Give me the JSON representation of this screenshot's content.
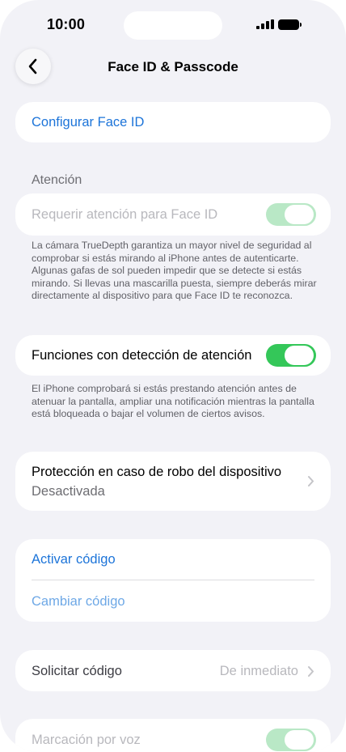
{
  "status_bar": {
    "time": "10:00"
  },
  "nav": {
    "title": "Face ID & Passcode"
  },
  "face_id": {
    "setup_label": "Configurar Face ID"
  },
  "attention": {
    "header": "Atención",
    "require_label": "Requerir atención para Face ID",
    "require_enabled": true,
    "require_disabled_state": true,
    "require_footnote": "La cámara TrueDepth garantiza un mayor nivel de seguridad al comprobar si estás mirando al iPhone antes de autenticarte. Algunas gafas de sol pueden impedir que se detecte si estás mirando. Si llevas una mascarilla puesta, siempre deberás mirar directamente al dispositivo para que Face ID te reconozca.",
    "aware_label": "Funciones con detección de atención",
    "aware_enabled": true,
    "aware_footnote": "El iPhone comprobará si estás prestando atención antes de atenuar la pantalla, ampliar una notificación mientras la pantalla está bloqueada o bajar el volumen de ciertos avisos."
  },
  "stolen_device": {
    "label": "Protección en caso de robo del dispositivo",
    "value": "Desactivada"
  },
  "passcode": {
    "turn_on_label": "Activar código",
    "change_label": "Cambiar código"
  },
  "require_passcode": {
    "label": "Solicitar código",
    "value": "De inmediato"
  },
  "voice_dial": {
    "label": "Marcación por voz",
    "enabled": true,
    "disabled_state": true
  },
  "colors": {
    "accent": "#1c74d9",
    "switch_on": "#34c759",
    "background": "#f2f2f7"
  }
}
